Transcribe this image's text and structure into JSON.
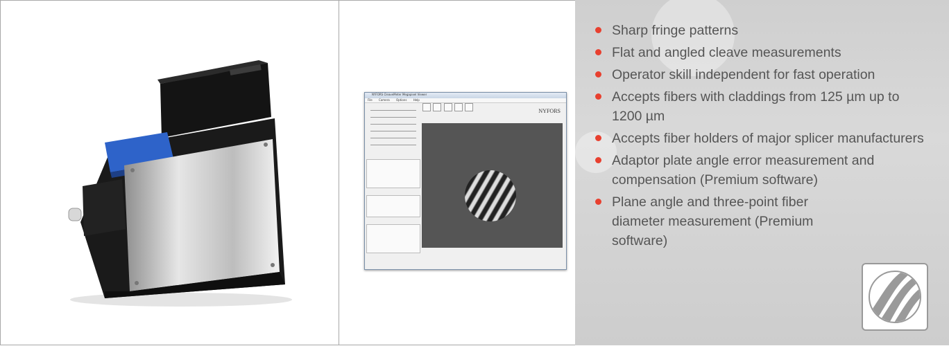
{
  "features": [
    "Sharp fringe patterns",
    "Flat and angled cleave measurements",
    "Operator skill independent for fast operation",
    "Accepts fibers with claddings from 125 µm up to 1200 µm",
    "Accepts fiber holders of major splicer manufacturers",
    "Adaptor plate angle error measurement and compensation (Premium software)",
    "Plane angle and three-point fiber diameter measurement (Premium software)"
  ],
  "software_window": {
    "title": "NYFORS CleaveMeter Megapixel Viewer",
    "menu": [
      "File",
      "Camera",
      "Options",
      "Help"
    ],
    "brand": "NYFORS"
  },
  "colors": {
    "bullet": "#e8402f",
    "text": "#555555",
    "panel_bg": "#d4d4d4"
  },
  "icons": [
    "fiber-stripes-logo-icon"
  ]
}
